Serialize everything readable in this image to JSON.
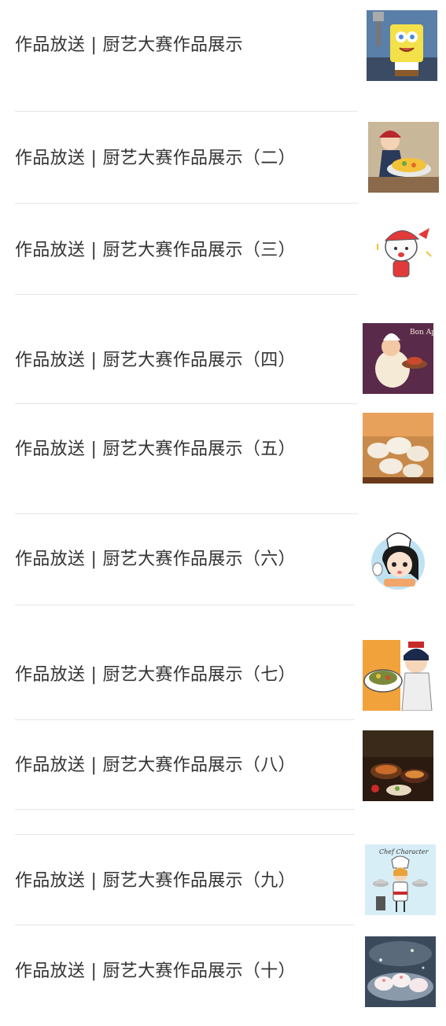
{
  "articles": [
    {
      "title": "作品放送 | 厨艺大赛作品展示",
      "thumbnail": "spongebob-chef-cartoon"
    },
    {
      "title": "作品放送 | 厨艺大赛作品展示（二）",
      "thumbnail": "anime-chef-serving-dish"
    },
    {
      "title": "作品放送 | 厨艺大赛作品展示（三）",
      "thumbnail": "cute-chef-sticker"
    },
    {
      "title": "作品放送 | 厨艺大赛作品展示（四）",
      "thumbnail": "bon-appetit-chef-illustration"
    },
    {
      "title": "作品放送 | 厨艺大赛作品展示（五）",
      "thumbnail": "dumplings-photo"
    },
    {
      "title": "作品放送 | 厨艺大赛作品展示（六）",
      "thumbnail": "chef-girl-cartoon"
    },
    {
      "title": "作品放送 | 厨艺大赛作品展示（七）",
      "thumbnail": "anime-cook-with-plate"
    },
    {
      "title": "作品放送 | 厨艺大赛作品展示（八）",
      "thumbnail": "feast-table-photo"
    },
    {
      "title": "作品放送 | 厨艺大赛作品展示（九）",
      "thumbnail": "chef-character-illustration"
    },
    {
      "title": "作品放送 | 厨艺大赛作品展示（十）",
      "thumbnail": "steamed-buns-photo"
    }
  ],
  "thumbnail_texts": {
    "bon_appetit": "Bon Appetit",
    "chef_character": "Chef Character"
  }
}
